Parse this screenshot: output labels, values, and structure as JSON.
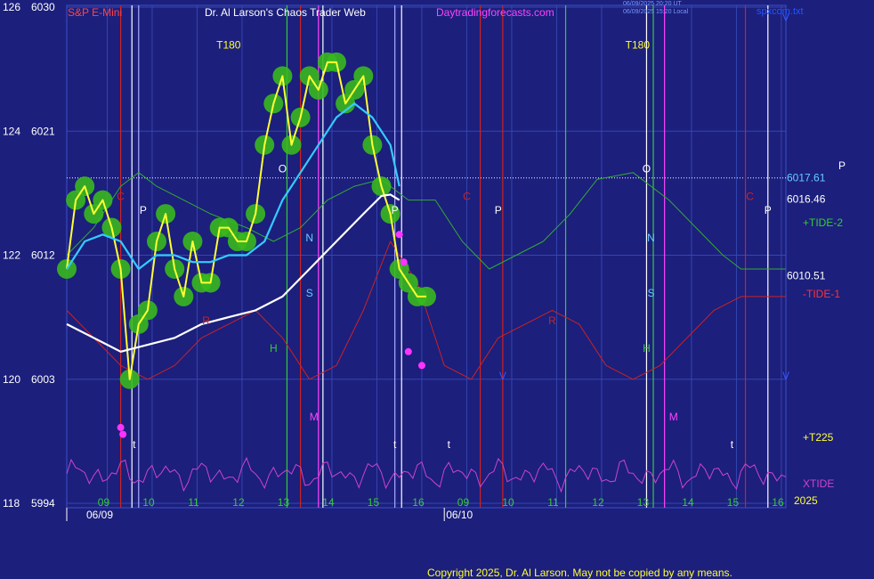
{
  "header": {
    "instrument": "S&P E-Mini",
    "title": "Dr. Al Larson's Chaos Trader Web",
    "site": "Daytradingforecasts.com",
    "timestamp_line1": "06/09/2025 20:20 UT",
    "timestamp_line2": "06/09/2025 15:20 Local",
    "chart_file": "spxcom.txt"
  },
  "copyright": "Copyright 2025, Dr. Al Larson. May not be copied by any means.",
  "year": "2025",
  "colors": {
    "background": "#1c1f7c",
    "price_line": "#ffff33",
    "price_envelope": "#39b81e",
    "fast_ma": "#33ccff",
    "slow_ma": "#ffffff",
    "tide_plus": "#33aa33",
    "tide_minus": "#cc2222",
    "xtide": "#cc44cc",
    "pivot_dots": "#ff33ff"
  },
  "chart_data": {
    "type": "line",
    "title": "S&P E-Mini",
    "x_date_labels": [
      "06/09",
      "06/10"
    ],
    "x_hour_labels": [
      "09",
      "10",
      "11",
      "12",
      "13",
      "14",
      "15",
      "16",
      "09",
      "10",
      "11",
      "12",
      "13",
      "14",
      "15",
      "16"
    ],
    "y_ticks": [
      {
        "left": "126",
        "right": "6030",
        "value": 6030
      },
      {
        "left": "124",
        "right": "6021",
        "value": 6021
      },
      {
        "left": "122",
        "right": "6012",
        "value": 6012
      },
      {
        "left": "120",
        "right": "6003",
        "value": 6003
      },
      {
        "left": "118",
        "right": "5994",
        "value": 5994
      }
    ],
    "ylim": [
      5994,
      6030
    ],
    "xlim": [
      0,
      16
    ],
    "price_labels": [
      {
        "text": "6017.61",
        "value": 6017.61,
        "color": "#66ccff"
      },
      {
        "text": "6016.46",
        "value": 6016.46,
        "color": "#ffffff"
      },
      {
        "text": "6010.51",
        "value": 6010.51,
        "color": "#ffffff"
      }
    ],
    "reference_level": 6017.61,
    "series": [
      {
        "name": "S&P E-Mini",
        "color": "#ffff33",
        "x": [
          0,
          0.2,
          0.4,
          0.6,
          0.8,
          1.0,
          1.2,
          1.4,
          1.6,
          1.8,
          2.0,
          2.2,
          2.4,
          2.6,
          2.8,
          3.0,
          3.2,
          3.4,
          3.6,
          3.8,
          4.0,
          4.2,
          4.4,
          4.6,
          4.8,
          5.0,
          5.2,
          5.4,
          5.6,
          5.8,
          6.0,
          6.2,
          6.4,
          6.6,
          6.8,
          7.0,
          7.2,
          7.4,
          7.6,
          7.8,
          8.0
        ],
        "values": [
          6011,
          6016,
          6017,
          6015,
          6016,
          6014,
          6011,
          6003,
          6007,
          6008,
          6013,
          6015,
          6011,
          6009,
          6013,
          6010,
          6010,
          6014,
          6014,
          6013,
          6013,
          6015,
          6020,
          6023,
          6025,
          6020,
          6022,
          6025,
          6024,
          6026,
          6026,
          6023,
          6024,
          6025,
          6020,
          6017,
          6015,
          6011,
          6010,
          6009,
          6009
        ]
      },
      {
        "name": "fast average",
        "color": "#33ccff",
        "x": [
          0,
          0.4,
          0.8,
          1.2,
          1.6,
          2.0,
          2.4,
          2.8,
          3.2,
          3.6,
          4.0,
          4.4,
          4.8,
          5.2,
          5.6,
          6.0,
          6.4,
          6.8,
          7.2,
          7.4
        ],
        "values": [
          6011,
          6013,
          6013.5,
          6013,
          6011,
          6012,
          6012,
          6011.5,
          6011.5,
          6012,
          6012,
          6013,
          6016,
          6018,
          6020,
          6022,
          6023,
          6022,
          6020,
          6017
        ]
      },
      {
        "name": "slow average",
        "color": "#ffffff",
        "x": [
          0,
          0.6,
          1.2,
          1.8,
          2.4,
          3.0,
          3.6,
          4.2,
          4.8,
          5.4,
          6.0,
          6.6,
          7.0,
          7.2,
          7.4
        ],
        "values": [
          6007,
          6006,
          6005,
          6005.5,
          6006,
          6007,
          6007.5,
          6008,
          6009,
          6011,
          6013,
          6015,
          6016.3,
          6016.4,
          6016
        ]
      }
    ],
    "tides": [
      {
        "name": "+TIDE-2",
        "color": "#33aa33",
        "x": [
          0,
          0.6,
          1.2,
          1.6,
          2.0,
          2.6,
          3.2,
          4.0,
          4.6,
          5.2,
          5.8,
          6.4,
          7.0,
          7.6,
          8.2,
          8.8,
          9.4,
          10.0,
          10.6,
          11.2,
          11.8,
          12.6,
          13.4,
          14.0,
          14.6,
          15.0,
          15.6,
          16.0
        ],
        "values": [
          6012,
          6014,
          6017,
          6018,
          6017,
          6016,
          6015,
          6014,
          6013,
          6014,
          6016,
          6017,
          6017.5,
          6016,
          6016,
          6013,
          6011,
          6012,
          6013,
          6015,
          6017.5,
          6018,
          6016,
          6014,
          6012,
          6011,
          6011,
          6011
        ]
      },
      {
        "name": "-TIDE-1",
        "color": "#cc2222",
        "x": [
          0,
          0.6,
          1.2,
          1.8,
          2.4,
          3.0,
          3.6,
          4.2,
          4.8,
          5.4,
          6.0,
          6.6,
          7.2,
          7.8,
          8.4,
          9.0,
          9.6,
          10.2,
          10.8,
          11.4,
          12.0,
          12.6,
          13.2,
          13.8,
          14.4,
          15.0,
          15.6,
          16.0
        ],
        "values": [
          6008,
          6006,
          6004,
          6003,
          6004,
          6006,
          6007,
          6008,
          6006,
          6003,
          6004,
          6008,
          6013,
          6010,
          6004,
          6003,
          6006,
          6007,
          6008,
          6007,
          6004,
          6003,
          6004,
          6006,
          6008,
          6009,
          6009,
          6009
        ]
      }
    ],
    "annotations": [
      "T180",
      "T180",
      "O",
      "O",
      "P",
      "P",
      "P",
      "P",
      "C",
      "C",
      "C",
      "N",
      "N",
      "S",
      "S",
      "H",
      "H",
      "M",
      "M",
      "R",
      "R",
      "V",
      "V",
      "V",
      "t",
      "t",
      "t",
      "t"
    ],
    "legend": [
      {
        "text": "P",
        "color": "#ffffff"
      },
      {
        "text": "+TIDE-2",
        "color": "#33cc33"
      },
      {
        "text": "-TIDE-1",
        "color": "#ff3333"
      },
      {
        "text": "+T225",
        "color": "#ffff33"
      },
      {
        "text": "XTIDE",
        "color": "#cc44cc"
      }
    ]
  }
}
